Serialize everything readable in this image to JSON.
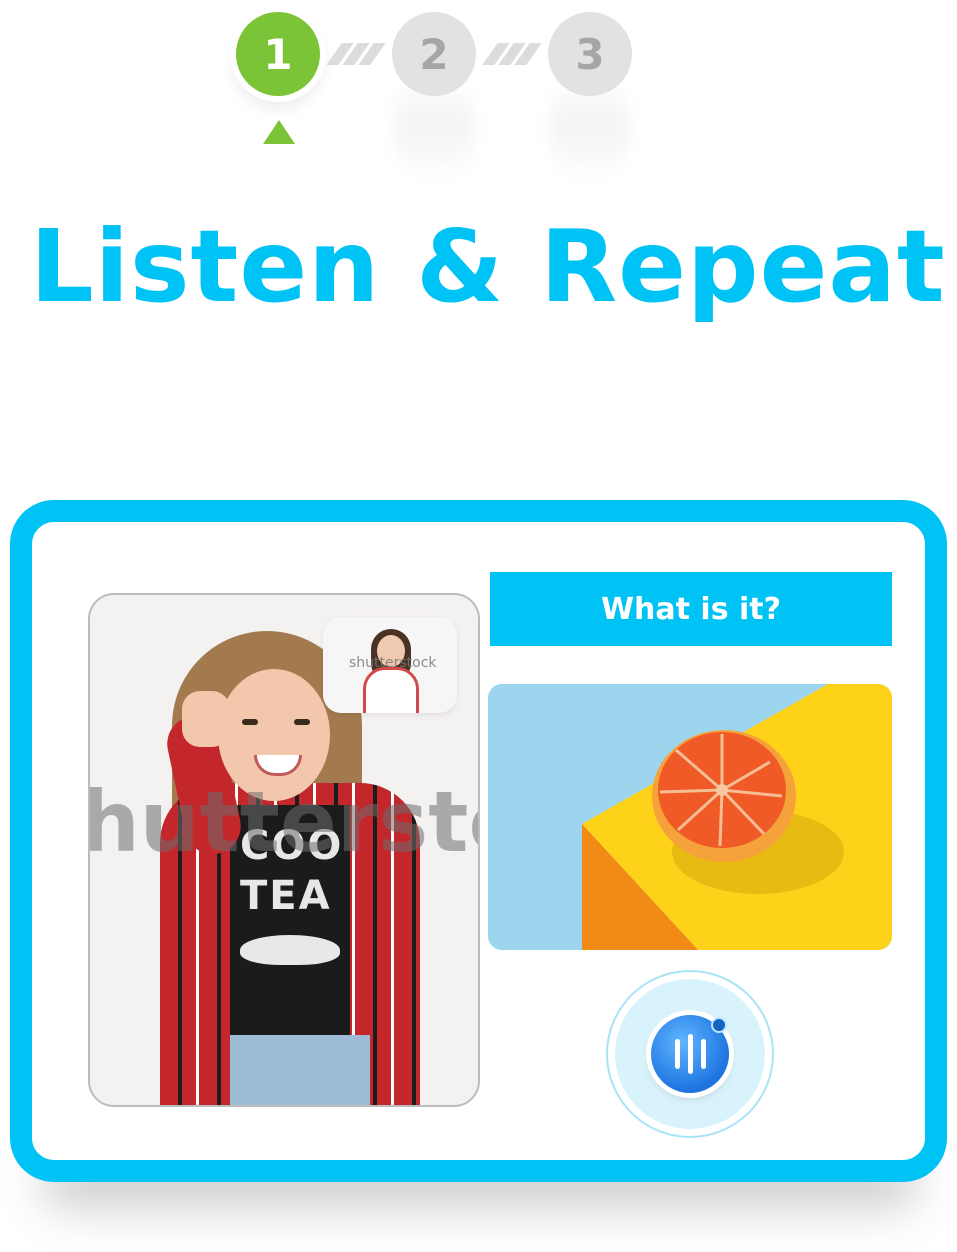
{
  "stepper": {
    "steps": [
      {
        "label": "1",
        "state": "active"
      },
      {
        "label": "2",
        "state": "inactive"
      },
      {
        "label": "3",
        "state": "inactive"
      }
    ],
    "active_color": "#7cc437",
    "inactive_color": "#e2e2e2"
  },
  "page": {
    "title": "Listen & Repeat",
    "title_color": "#00c3f5"
  },
  "activity": {
    "accent_color": "#00c3f5",
    "video": {
      "main_feed": "girl-thumbs-up-photo",
      "watermark": "hutterstoc",
      "pip_label": "shutterstock"
    },
    "question": "What is it?",
    "prompt_image": "half-grapefruit-on-yellow-block",
    "record_button": {
      "icon": "audio-bars-icon",
      "color": "#1e74e0"
    }
  }
}
